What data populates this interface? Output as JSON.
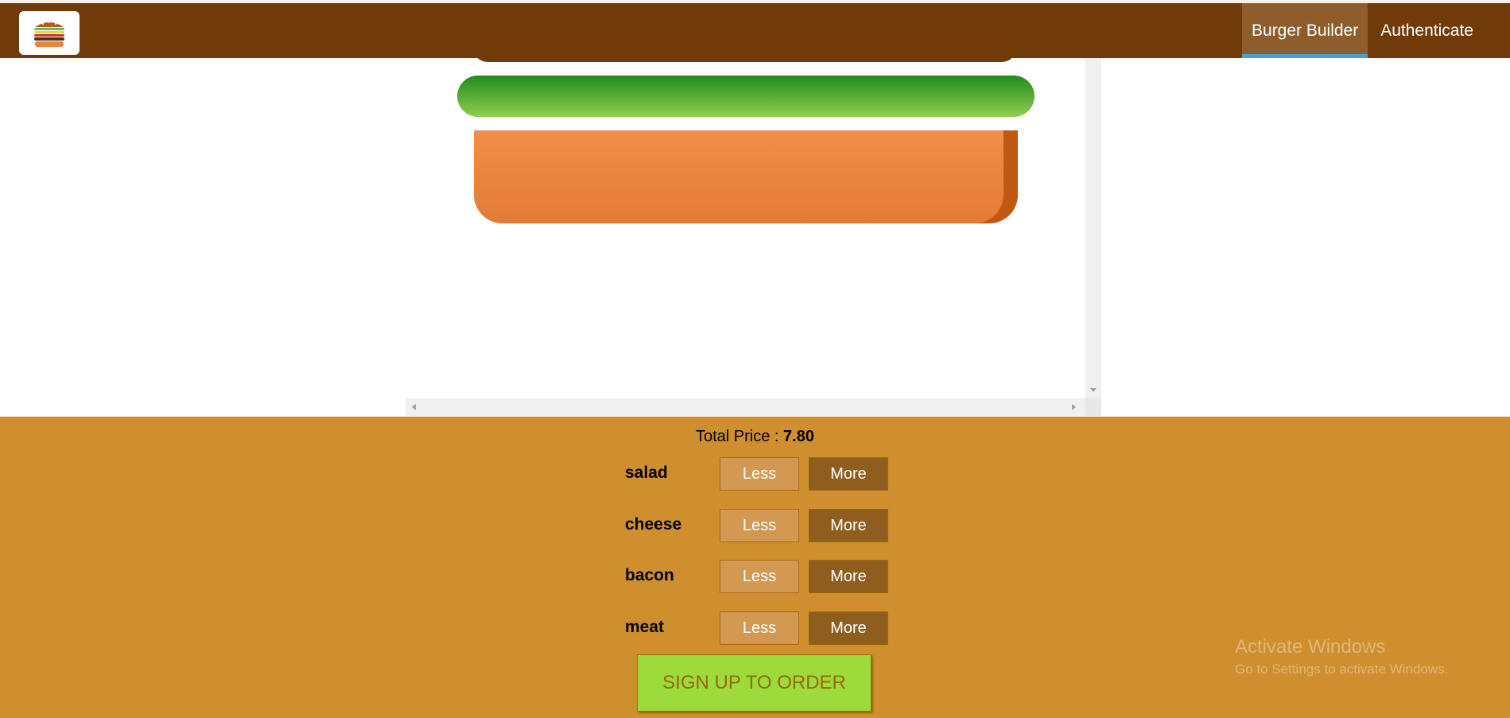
{
  "header": {
    "logo_icon": "burger-logo-icon",
    "nav": [
      {
        "label": "Burger Builder",
        "active": true
      },
      {
        "label": "Authenticate",
        "active": false
      }
    ]
  },
  "colors": {
    "toolbar": "#703b09",
    "controls_bg": "#cf8f2e",
    "less_button": "#d39952",
    "more_button": "#8f5e1e",
    "order_button": "#9ddb3c",
    "active_underline": "#40a4c8"
  },
  "burger": {
    "visible_layers": [
      "bun-top",
      "salad",
      "bun-bottom"
    ]
  },
  "controls": {
    "price_label": "Total Price :",
    "price_value": "7.80",
    "ingredients": [
      {
        "label": "salad",
        "less": "Less",
        "more": "More"
      },
      {
        "label": "cheese",
        "less": "Less",
        "more": "More"
      },
      {
        "label": "bacon",
        "less": "Less",
        "more": "More"
      },
      {
        "label": "meat",
        "less": "Less",
        "more": "More"
      }
    ],
    "order_label": "SIGN UP TO ORDER"
  },
  "watermark": {
    "line1": "Activate Windows",
    "line2": "Go to Settings to activate Windows."
  }
}
